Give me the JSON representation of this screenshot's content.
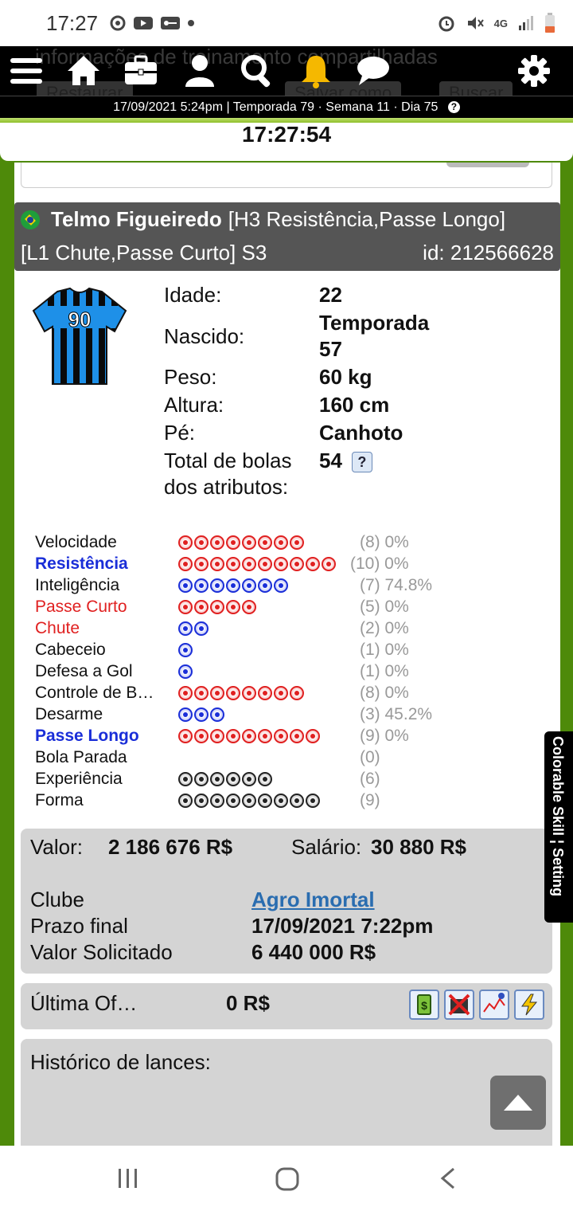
{
  "status_bar": {
    "time": "17:27",
    "network": "4G"
  },
  "ghost": {
    "text": "informações de treinamento compartilhadas",
    "btn1": "Restaurar",
    "btn2": "Salvar como",
    "btn3": "Buscar"
  },
  "date_bar": "17/09/2021 5:24pm | Temporada 79 · Semana 11 · Dia 75",
  "clock": "17:27:54",
  "player": {
    "name": "Telmo Figueiredo",
    "line1_rest": "[H3 Resistência,Passe Longo]",
    "line2": "[L1 Chute,Passe Curto] S3",
    "id": "id: 212566628",
    "shirt_number": "90"
  },
  "info": [
    {
      "label": "Idade:",
      "value": "22"
    },
    {
      "label": "Nascido:",
      "value": "Temporada 57"
    },
    {
      "label": "Peso:",
      "value": "60 kg"
    },
    {
      "label": "Altura:",
      "value": "160 cm"
    },
    {
      "label": "Pé:",
      "value": "Canhoto"
    },
    {
      "label": "Total de bolas dos atributos:",
      "value": "54",
      "help": "?"
    }
  ],
  "skills": [
    {
      "name": "Velocidade",
      "balls": 8,
      "color": "red",
      "value": "(8) 0%",
      "name_color": "#111",
      "bold": false
    },
    {
      "name": "Resistência",
      "balls": 10,
      "color": "red",
      "value": "(10) 0%",
      "name_color": "#1a2ed8",
      "bold": true
    },
    {
      "name": "Inteligência",
      "balls": 7,
      "color": "blue",
      "value": "(7) 74.8%",
      "name_color": "#111",
      "bold": false
    },
    {
      "name": "Passe Curto",
      "balls": 5,
      "color": "red",
      "value": "(5) 0%",
      "name_color": "#e02020",
      "bold": false
    },
    {
      "name": "Chute",
      "balls": 2,
      "color": "blue",
      "value": "(2) 0%",
      "name_color": "#e02020",
      "bold": false
    },
    {
      "name": "Cabeceio",
      "balls": 1,
      "color": "blue",
      "value": "(1) 0%",
      "name_color": "#111",
      "bold": false
    },
    {
      "name": "Defesa a Gol",
      "balls": 1,
      "color": "blue",
      "value": "(1) 0%",
      "name_color": "#111",
      "bold": false
    },
    {
      "name": "Controle de B…",
      "balls": 8,
      "color": "red",
      "value": "(8) 0%",
      "name_color": "#111",
      "bold": false
    },
    {
      "name": "Desarme",
      "balls": 3,
      "color": "blue",
      "value": "(3) 45.2%",
      "name_color": "#111",
      "bold": false
    },
    {
      "name": "Passe Longo",
      "balls": 9,
      "color": "red",
      "value": "(9) 0%",
      "name_color": "#1a2ed8",
      "bold": true
    },
    {
      "name": "Bola Parada",
      "balls": 0,
      "color": "red",
      "value": "(0)",
      "name_color": "#111",
      "bold": false
    },
    {
      "name": "Experiência",
      "balls": 6,
      "color": "black",
      "value": "(6)",
      "name_color": "#111",
      "bold": false
    },
    {
      "name": "Forma",
      "balls": 9,
      "color": "black",
      "value": "(9)",
      "name_color": "#111",
      "bold": false
    }
  ],
  "market": {
    "valor_label": "Valor:",
    "valor": "2 186 676 R$",
    "salario_label": "Salário:",
    "salario": "30 880 R$",
    "clube_label": "Clube",
    "clube": "Agro Imortal",
    "prazo_label": "Prazo final",
    "prazo": "17/09/2021 7:22pm",
    "solicitado_label": "Valor Solicitado",
    "solicitado": "6 440 000 R$"
  },
  "offer": {
    "label": "Última Of…",
    "value": "0 R$"
  },
  "history": {
    "label": "Histórico de lances:"
  },
  "side_tab": "Colorable Skill ¦ Setting"
}
